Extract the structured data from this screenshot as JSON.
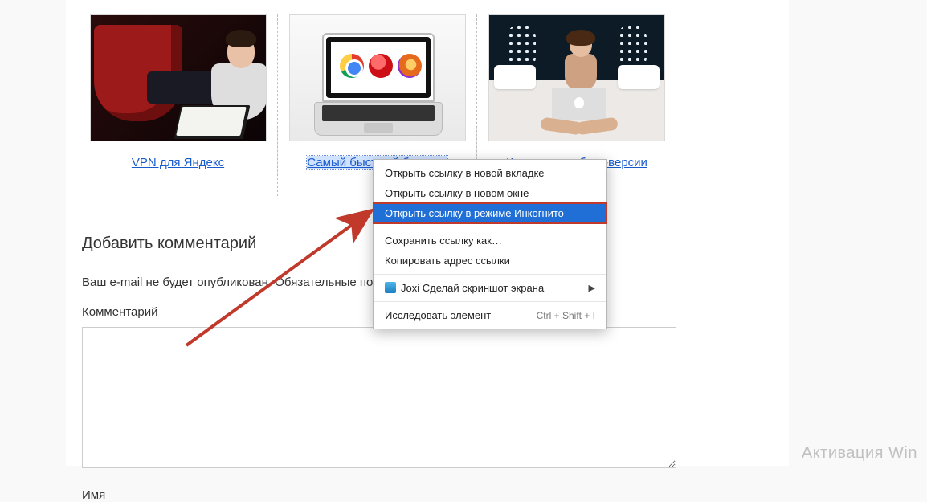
{
  "cards": [
    {
      "link_text": "VPN для Яндекс"
    },
    {
      "link_text": "Самый быстрый браузер"
    },
    {
      "link_text": "Коллекции в бета-версии Яндекс."
    }
  ],
  "comments": {
    "heading": "Добавить комментарий",
    "note": "Ваш e-mail не будет опубликован. Обязательные поля помечены *",
    "comment_label": "Комментарий",
    "name_label": "Имя"
  },
  "context_menu": {
    "open_tab": "Открыть ссылку в новой вкладке",
    "open_window": "Открыть ссылку в новом окне",
    "open_incognito": "Открыть ссылку в режиме Инкогнито",
    "save_as": "Сохранить ссылку как…",
    "copy_addr": "Копировать адрес ссылки",
    "joxi": "Joxi Сделай скриншот экрана",
    "inspect": "Исследовать элемент",
    "inspect_shortcut": "Ctrl + Shift + I"
  },
  "watermark": "Активация Win"
}
